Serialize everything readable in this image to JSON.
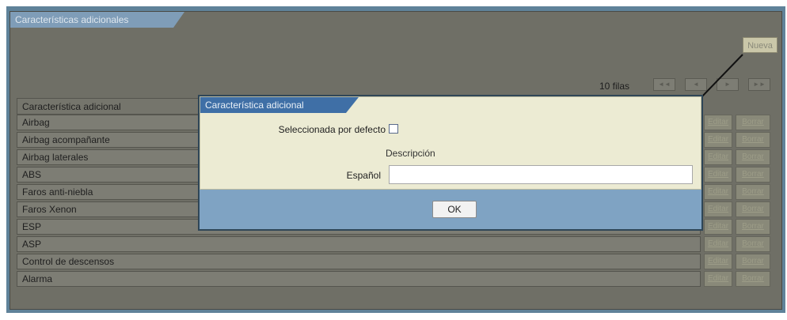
{
  "panel": {
    "title": "Características adicionales",
    "new_button": "Nueva",
    "rows_count": "10 filas",
    "pager": [
      {
        "name": "first-page-button",
        "glyph": "◄◄"
      },
      {
        "name": "prev-page-button",
        "glyph": "◄"
      },
      {
        "name": "next-page-button",
        "glyph": "►"
      },
      {
        "name": "last-page-button",
        "glyph": "►►"
      }
    ]
  },
  "table": {
    "header": "Característica adicional",
    "edit_label": "Editar",
    "delete_label": "Borrar",
    "rows": [
      "Airbag",
      "Airbag acompañante",
      "Airbag laterales",
      "ABS",
      "Faros anti-niebla",
      "Faros Xenon",
      "ESP",
      "ASP",
      "Control de descensos",
      "Alarma"
    ]
  },
  "dialog": {
    "title": "Característica adicional",
    "selected_label": "Seleccionada por defecto",
    "description_label": "Descripción",
    "spanish_label": "Español",
    "spanish_value": "",
    "ok_label": "OK"
  }
}
